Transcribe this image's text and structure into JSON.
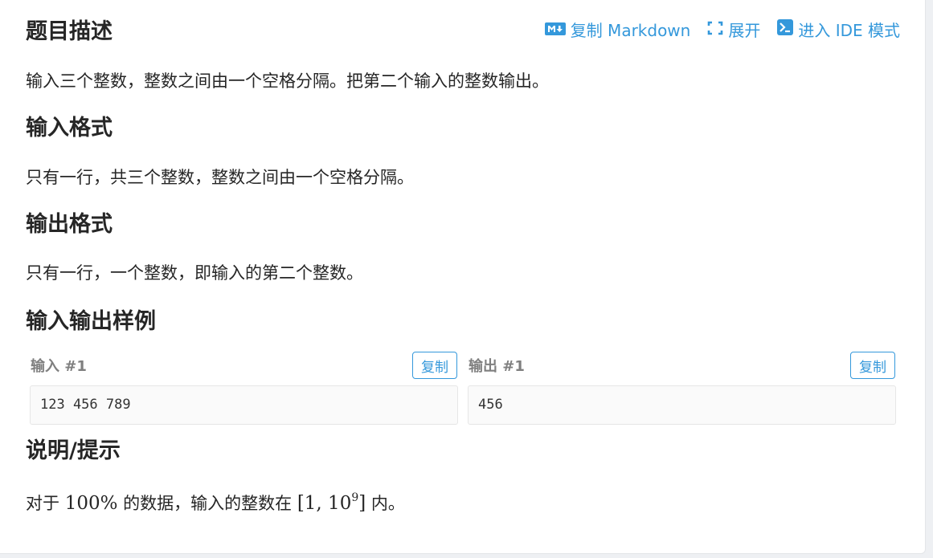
{
  "actions": {
    "copy_markdown": "复制 Markdown",
    "expand": "展开",
    "enter_ide": "进入 IDE 模式"
  },
  "sections": {
    "description": {
      "title": "题目描述",
      "text": "输入三个整数，整数之间由一个空格分隔。把第二个输入的整数输出。"
    },
    "input_format": {
      "title": "输入格式",
      "text": "只有一行，共三个整数，整数之间由一个空格分隔。"
    },
    "output_format": {
      "title": "输出格式",
      "text": "只有一行，一个整数，即输入的第二个整数。"
    },
    "samples": {
      "title": "输入输出样例",
      "input_label": "输入 #1",
      "output_label": "输出 #1",
      "copy_label": "复制",
      "input_value": "123 456 789",
      "output_value": "456"
    },
    "hint": {
      "title": "说明/提示",
      "prefix": "对于",
      "percent": "100%",
      "middle": "的数据，输入的整数在",
      "range_open": "[1, 10",
      "range_exp": "9",
      "range_close": "]",
      "suffix": "内。"
    }
  },
  "colors": {
    "accent": "#3498db",
    "text": "#262626",
    "muted": "#7f7f7f"
  },
  "icons": [
    "markdown-icon",
    "expand-icon",
    "terminal-icon"
  ]
}
